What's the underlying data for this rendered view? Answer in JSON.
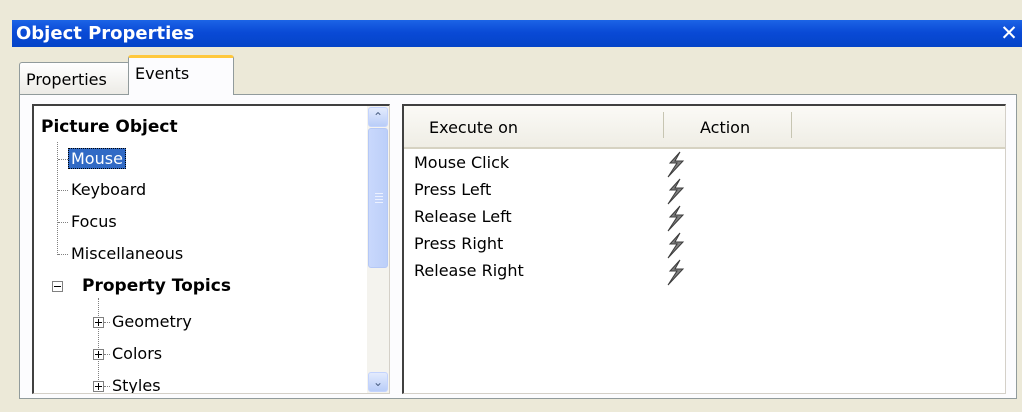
{
  "window": {
    "title": "Object Properties",
    "close_glyph": "✕"
  },
  "tabs": [
    {
      "label": "Properties",
      "active": false
    },
    {
      "label": "Events",
      "active": true
    }
  ],
  "tree": {
    "root": "Picture Object",
    "event_items": [
      "Mouse",
      "Keyboard",
      "Focus",
      "Miscellaneous"
    ],
    "selected": "Mouse",
    "property_topics": {
      "label": "Property Topics",
      "expanded": true,
      "children": [
        "Geometry",
        "Colors",
        "Styles"
      ]
    },
    "scroll_up_glyph": "⌃",
    "scroll_down_glyph": "⌄"
  },
  "grid": {
    "columns": [
      "Execute on",
      "Action"
    ],
    "rows": [
      {
        "execute_on": "Mouse Click",
        "action_icon": "lightning-bolt-icon"
      },
      {
        "execute_on": "Press Left",
        "action_icon": "lightning-bolt-icon"
      },
      {
        "execute_on": "Release Left",
        "action_icon": "lightning-bolt-icon"
      },
      {
        "execute_on": "Press Right",
        "action_icon": "lightning-bolt-icon"
      },
      {
        "execute_on": "Release Right",
        "action_icon": "lightning-bolt-icon"
      }
    ]
  },
  "colors": {
    "titlebar": "#0a4ad6",
    "selection": "#316ac5",
    "active_tab_highlight": "#ffc83c",
    "dialog_background": "#ece9d8"
  }
}
